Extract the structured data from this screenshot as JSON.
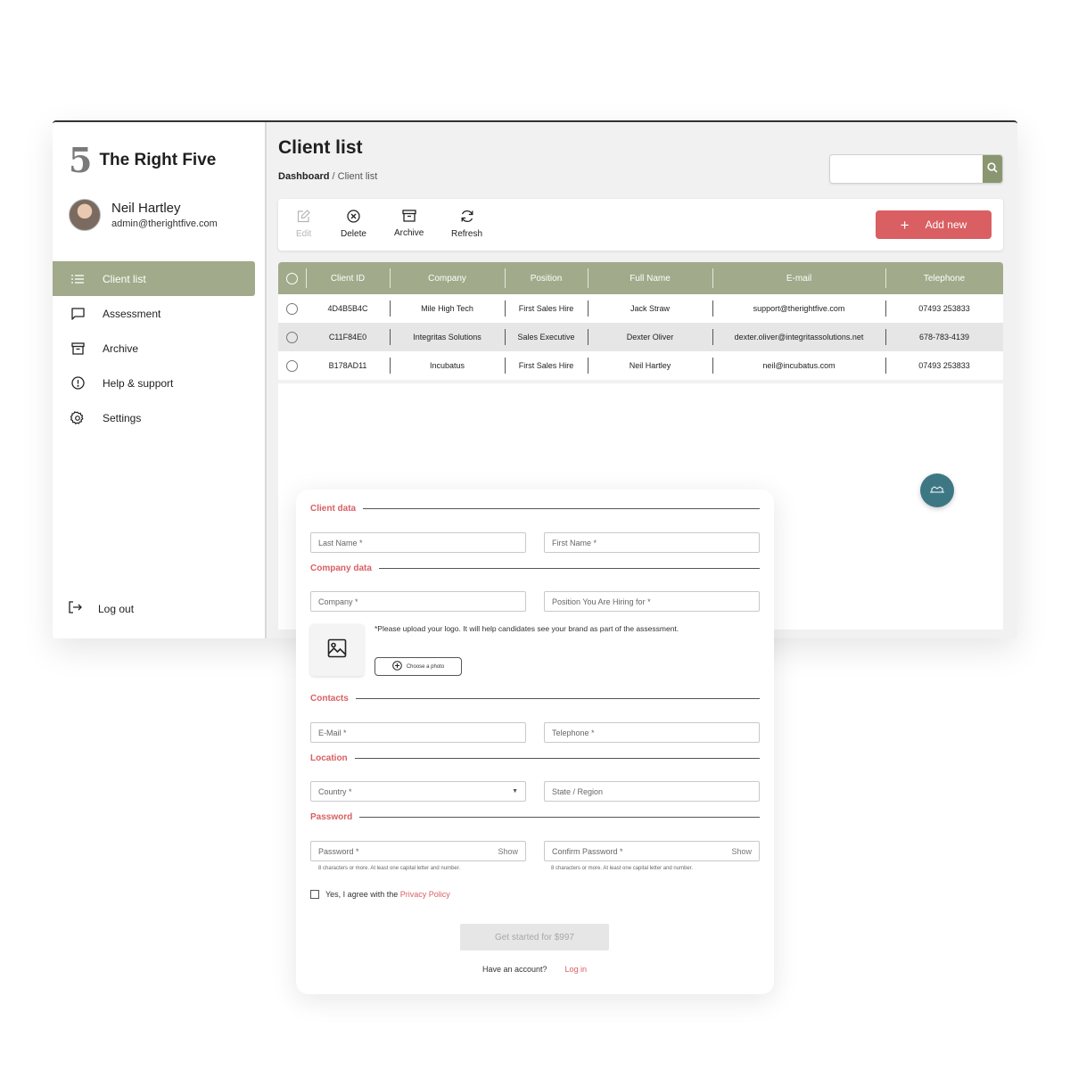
{
  "brand": {
    "logo": "5",
    "name": "The Right Five"
  },
  "user": {
    "name": "Neil Hartley",
    "email": "admin@therightfive.com"
  },
  "sidebar": {
    "items": [
      {
        "label": "Client list",
        "icon": "list-icon",
        "active": true
      },
      {
        "label": "Assessment",
        "icon": "message-square-icon"
      },
      {
        "label": "Archive",
        "icon": "archive-box-icon"
      },
      {
        "label": "Help & support",
        "icon": "alert-circle-icon"
      },
      {
        "label": "Settings",
        "icon": "gear-icon"
      }
    ],
    "logout": "Log out"
  },
  "header": {
    "title": "Client list",
    "breadcrumb_root": "Dashboard",
    "breadcrumb_sep": " / ",
    "breadcrumb_current": "Client list",
    "search_placeholder": ""
  },
  "toolbar": {
    "edit": "Edit",
    "delete": "Delete",
    "archive": "Archive",
    "refresh": "Refresh",
    "add_new": "Add new",
    "add_plus": "+"
  },
  "table": {
    "columns": [
      "Client ID",
      "Company",
      "Position",
      "Full Name",
      "E-mail",
      "Telephone"
    ],
    "rows": [
      [
        "4D4B5B4C",
        "Mile High Tech",
        "First Sales Hire",
        "Jack Straw",
        "support@therightfive.com",
        "07493 253833"
      ],
      [
        "C11F84E0",
        "Integritas Solutions",
        "Sales Executive",
        "Dexter Oliver",
        "dexter.oliver@integritassolutions.net",
        "678-783-4139"
      ],
      [
        "B178AD11",
        "Incubatus",
        "First Sales Hire",
        "Neil Hartley",
        "neil@incubatus.com",
        "07493 253833"
      ]
    ]
  },
  "form": {
    "sections": {
      "client": "Client data",
      "company": "Company data",
      "contacts": "Contacts",
      "location": "Location",
      "password": "Password"
    },
    "fields": {
      "last_name": "Last Name *",
      "first_name": "First Name *",
      "company": "Company *",
      "position": "Position You Are Hiring for *",
      "email": "E-Mail *",
      "telephone": "Telephone *",
      "country": "Country *",
      "state": "State / Region",
      "password": "Password *",
      "confirm_password": "Confirm Password *",
      "show": "Show"
    },
    "password_hint": "8 characters or more. At least one capital letter and number.",
    "upload_note": "*Please upload your logo. It will help candidates see your brand as part of the assessment.",
    "choose_photo": "Choose a photo",
    "agree_text": "Yes, I agree with the ",
    "privacy_policy": "Privacy Policy",
    "submit": "Get started for $997",
    "have_account": "Have an account?",
    "login": "Log in"
  },
  "colors": {
    "accent_green": "#a1aa8a",
    "search_button": "#8a9670",
    "accent_red": "#d95f63",
    "chat_teal": "#3e7784"
  }
}
